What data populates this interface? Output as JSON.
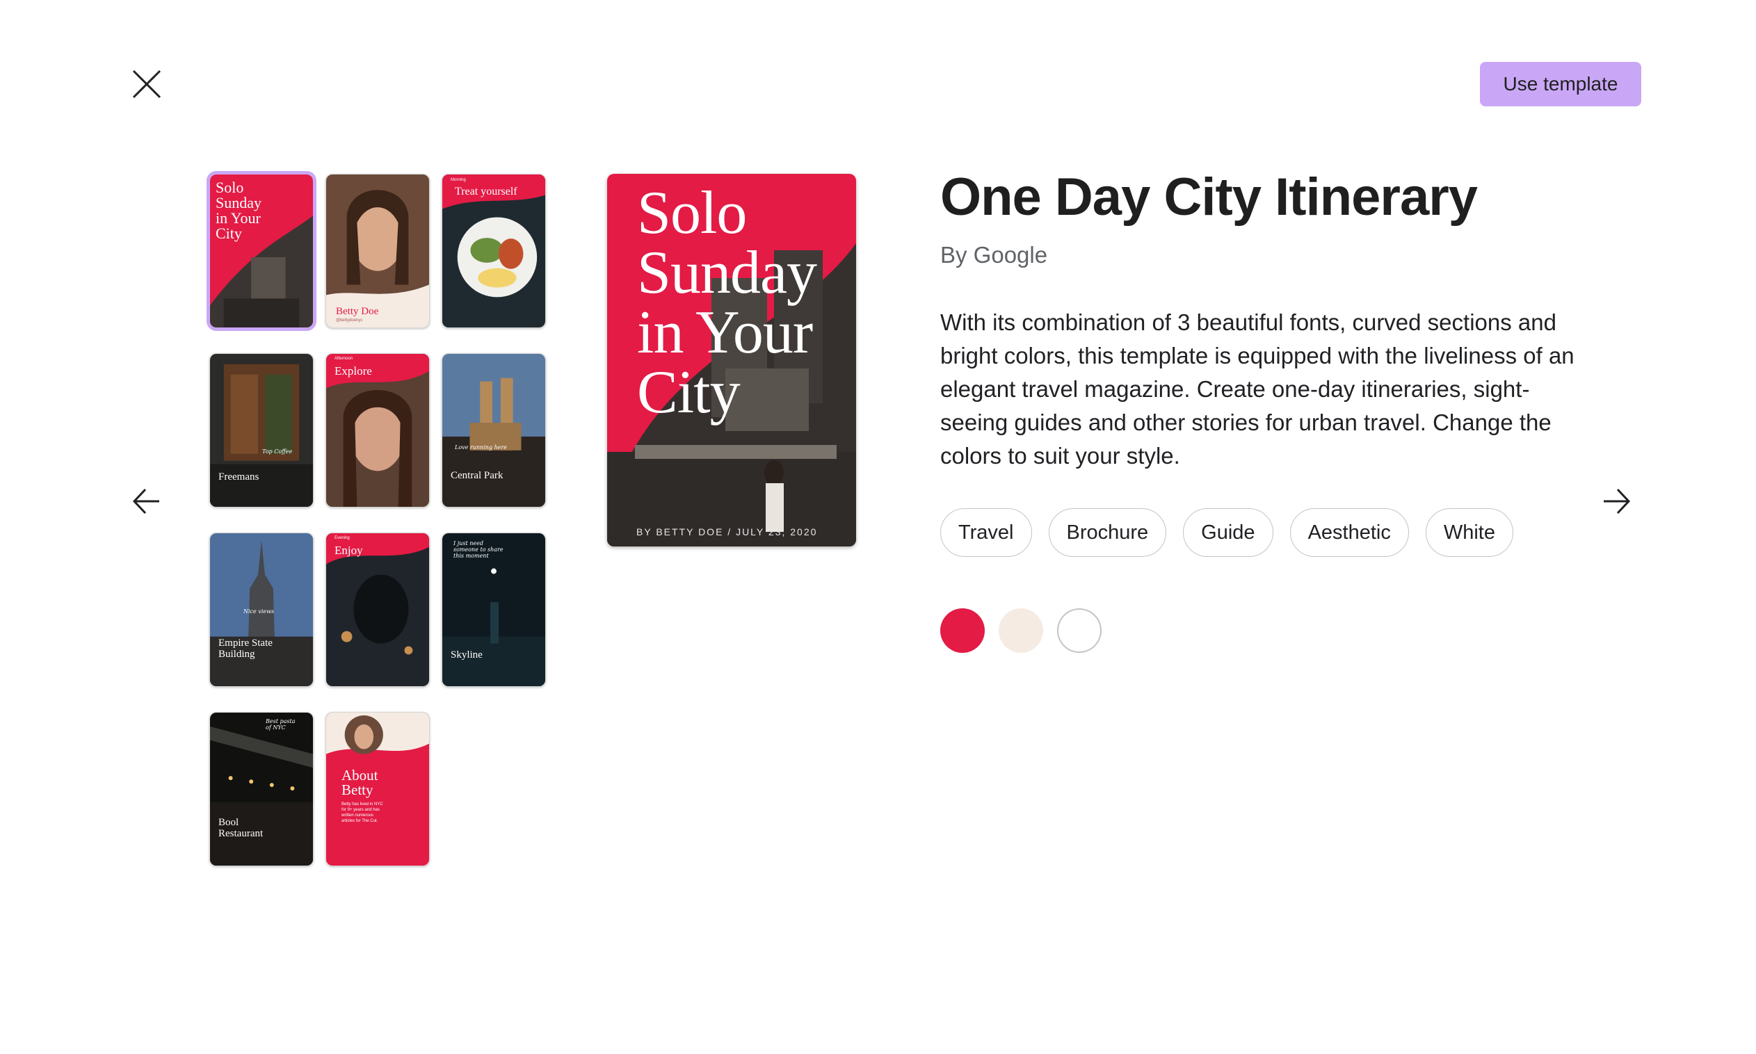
{
  "toolbar": {
    "close_icon": "close-icon",
    "use_template_label": "Use template"
  },
  "navigation": {
    "prev_icon": "arrow-left-icon",
    "next_icon": "arrow-right-icon"
  },
  "template": {
    "title": "One Day City Itinerary",
    "author": "By Google",
    "description": "With its combination of 3 beautiful fonts, curved sections and bright colors, this template is equipped with the liveliness of an elegant travel magazine. Create one-day itineraries, sight-seeing guides and other stories for urban travel. Change the colors to suit your style.",
    "tags": [
      "Travel",
      "Brochure",
      "Guide",
      "Aesthetic",
      "White"
    ],
    "colors": [
      "#e31b45",
      "#f5ebe2",
      "#ffffff"
    ]
  },
  "preview": {
    "title": "Solo\nSunday\nin Your\nCity",
    "byline": "BY BETTY DOE / JULY 23, 2020"
  },
  "thumbnails": [
    {
      "title": "Solo\nSunday\nin Your\nCity",
      "small": ""
    },
    {
      "title": "Betty Doe",
      "small": "@bettydoenyc"
    },
    {
      "title": "Treat yourself",
      "small": "Morning"
    },
    {
      "title": "Freemans",
      "small": "Top Coffee"
    },
    {
      "title": "Explore",
      "small": "Afternoon"
    },
    {
      "title": "Central Park",
      "small": "Love running here"
    },
    {
      "title": "Empire State\nBuilding",
      "small": "Nice views"
    },
    {
      "title": "Enjoy",
      "small": "Evening"
    },
    {
      "title": "Skyline",
      "small": "I just need\nsomeone to share\nthis moment"
    },
    {
      "title": "Bool\nRestaurant",
      "small": "Best pasta\nof NYC"
    },
    {
      "title": "About\nBetty",
      "small": "Betty has lived in NYC\nfor 9+ years and has\nwritten numerous\narticles for The Cut."
    }
  ]
}
